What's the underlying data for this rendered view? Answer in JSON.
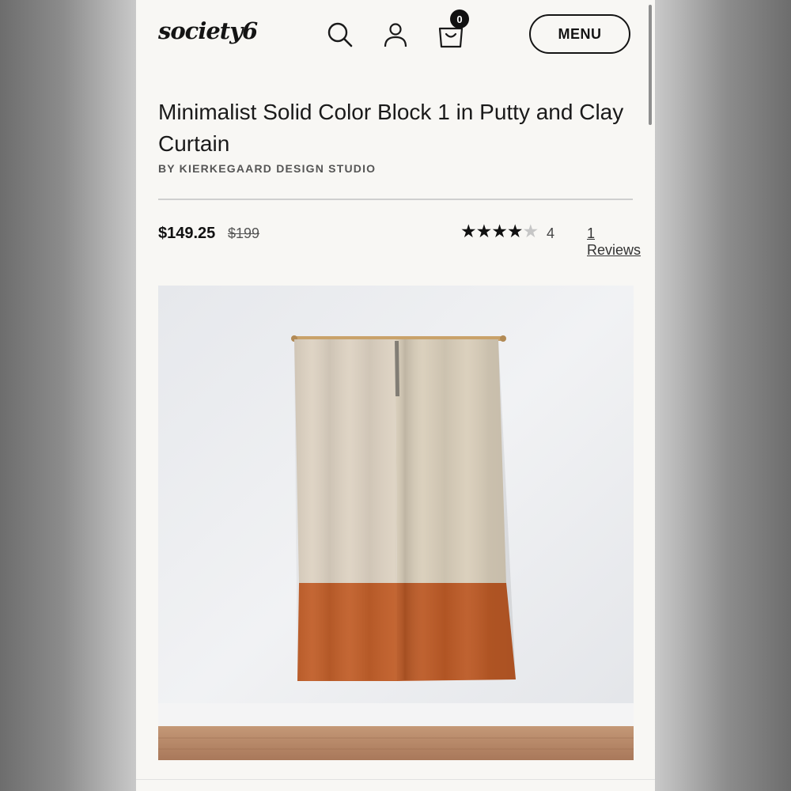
{
  "header": {
    "logo": "society6",
    "icons": [
      "search-icon",
      "account-icon",
      "cart-icon"
    ],
    "cart_count": "0",
    "menu_label": "MENU"
  },
  "product": {
    "title": "Minimalist Solid Color Block 1 in Putty and Clay Curtain",
    "byline": "BY KIERKEGAARD DESIGN STUDIO",
    "price": "$149.25",
    "original_price": "$199",
    "rating": 4,
    "rating_max": 5,
    "rating_label": "4",
    "reviews_label": "1 Reviews"
  },
  "colors": {
    "putty": "#ddd2c2",
    "clay": "#c15f2a",
    "wall": "#eceef0",
    "floor": "#b98a6c"
  }
}
